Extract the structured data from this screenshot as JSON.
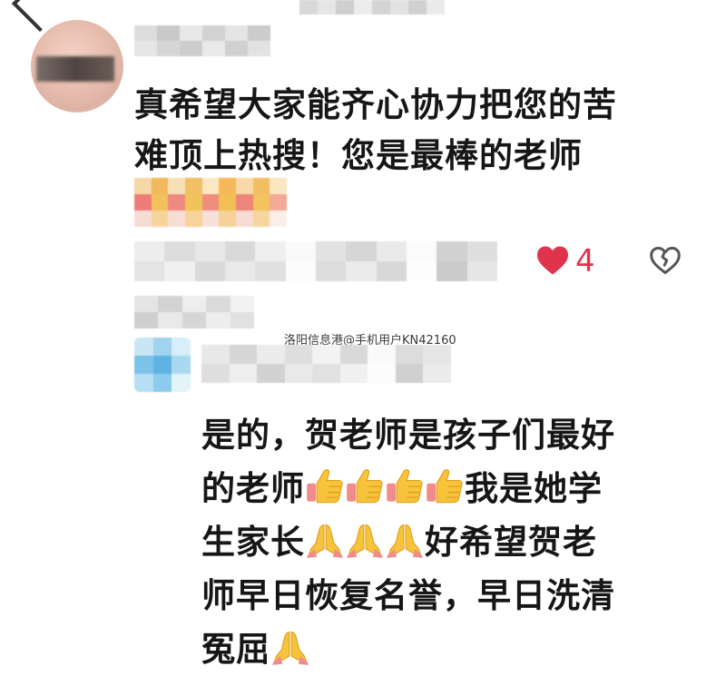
{
  "main_comment": {
    "text_line1": "真希望大家能齐心协力把您的苦",
    "text_line2": "难顶上热搜！您是最棒的老师",
    "like_count": "4",
    "icons": [
      "heart-icon",
      "broken-heart-icon"
    ]
  },
  "reply": {
    "line1": "是的，贺老师是孩子们最好",
    "line2_a": "的老师",
    "line2_b": "我是她学",
    "line3_a": "生家长",
    "line3_b": "好希望贺老",
    "line4": "师早日恢复名誉，早日洗清",
    "line5": "冤屈",
    "emojis": [
      "thumbs-up",
      "thumbs-up",
      "thumbs-up",
      "thumbs-up",
      "folded-hands",
      "folded-hands",
      "folded-hands",
      "folded-hands"
    ]
  },
  "watermark": "洛阳信息港@手机用户KN42160",
  "colors": {
    "like_red": "#e0344d",
    "text": "#161616",
    "icon_gray": "#555555"
  }
}
